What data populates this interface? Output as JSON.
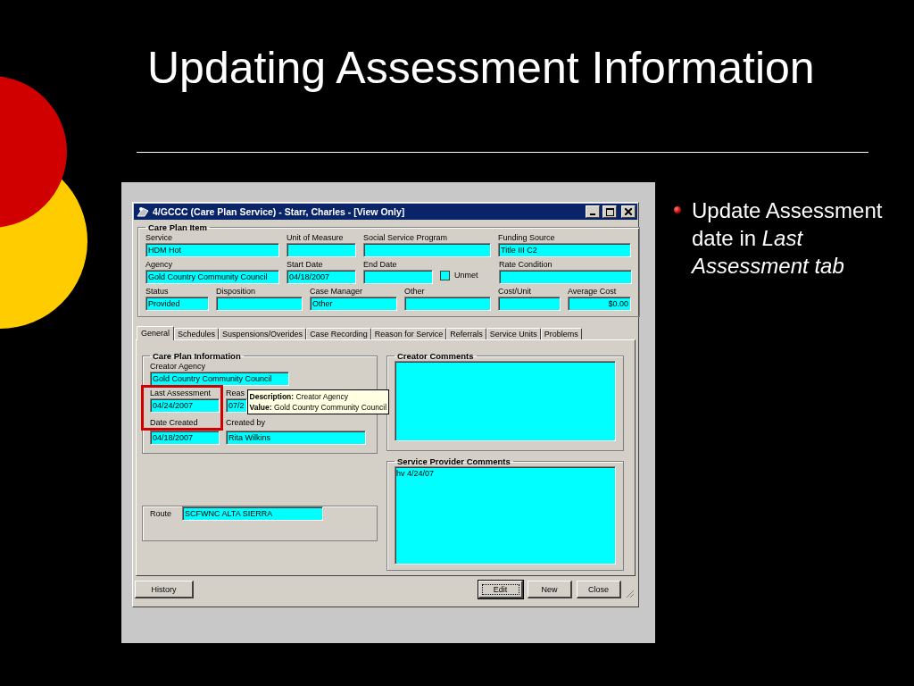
{
  "slide": {
    "title": "Updating Assessment Information",
    "bullets": [
      "Update Assessment date in *Last Assessment tab*"
    ]
  },
  "window": {
    "title": "4/GCCC (Care Plan Service) - Starr, Charles - [View Only]"
  },
  "care_plan_item": {
    "title": "Care Plan Item",
    "rows": [
      [
        {
          "kind": "field",
          "label": "Service",
          "value": "HDM Hot"
        },
        {
          "kind": "field",
          "label": "Unit of Measure"
        },
        {
          "kind": "field",
          "label": "Social Service Program"
        },
        {
          "kind": "field",
          "label": "Funding Source",
          "value": "Title III C2"
        }
      ],
      [
        {
          "kind": "field",
          "label": "Agency",
          "value": "Gold Country Community Council"
        },
        {
          "kind": "field",
          "label": "Start Date",
          "value": "04/18/2007"
        },
        {
          "kind": "field",
          "label": "End Date"
        },
        {
          "kind": "field",
          "label": "Rate Condition"
        }
      ],
      [
        {
          "kind": "field",
          "label": "Status",
          "value": "Provided"
        },
        {
          "kind": "field",
          "label": "Disposition"
        },
        {
          "kind": "field",
          "label": "Case Manager",
          "value": "Other"
        },
        {
          "kind": "field",
          "label": "Other"
        },
        {
          "kind": "field",
          "label": "Cost/Unit"
        },
        {
          "kind": "amount",
          "label": "Average Cost",
          "value": "$0.00"
        }
      ]
    ],
    "unmet": {
      "label": "Unmet",
      "checked": false
    }
  },
  "tabs": [
    {
      "label": "General",
      "selected": true
    },
    {
      "label": "Schedules",
      "selected": false
    },
    {
      "label": "Suspensions/Overides",
      "selected": false
    },
    {
      "label": "Case Recording",
      "selected": false
    },
    {
      "label": "Reason for Service",
      "selected": false
    },
    {
      "label": "Referrals",
      "selected": false
    },
    {
      "label": "Service Units",
      "selected": false
    },
    {
      "label": "Problems",
      "selected": false
    }
  ],
  "care_plan_information": {
    "title": "Care Plan Information",
    "creator_agency": {
      "label": "Creator Agency",
      "value": "Gold Country Community Council"
    },
    "last_assessment": {
      "label": "Last Assessment",
      "value": "04/24/2007"
    },
    "reason": {
      "label": "Reas",
      "value": "07/2"
    },
    "date_created": {
      "label": "Date Created",
      "value": "04/18/2007"
    },
    "created_by": {
      "label": "Created by",
      "value": "Rita Wilkins"
    }
  },
  "tooltip": {
    "lines": [
      "**Description:** Creator Agency",
      "**Value:** Gold Country Community Council"
    ]
  },
  "route": {
    "label": "Route",
    "value": "SCFWNC ALTA SIERRA"
  },
  "creator_comments": {
    "title": "Creator Comments"
  },
  "service_provider_comments": {
    "title": "Service Provider Comments",
    "value": "hv 4/24/07"
  },
  "buttons": [
    {
      "label": "History",
      "focused": false
    },
    {
      "label": "Edit",
      "focused": true
    },
    {
      "label": "New",
      "focused": false
    },
    {
      "label": "Close",
      "focused": false
    }
  ]
}
